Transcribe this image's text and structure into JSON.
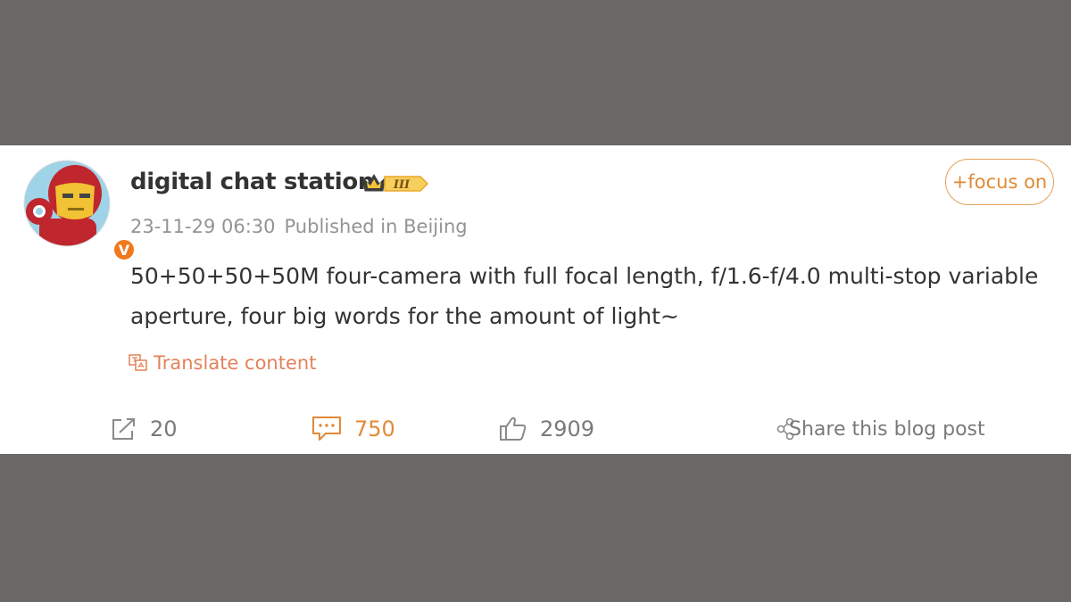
{
  "user": {
    "name": "digital chat station",
    "badge_level": "III",
    "verified_mark": "V"
  },
  "meta": {
    "timestamp": "23-11-29 06:30",
    "location": "Published in Beijing"
  },
  "follow_label": "+focus on",
  "post_text": "50+50+50+50M four-camera with full focal length, f/1.6-f/4.0 multi-stop variable aperture, four big words for the amount of light~",
  "translate_label": "Translate content",
  "actions": {
    "repost_count": "20",
    "comment_count": "750",
    "like_count": "2909",
    "share_label": "Share this blog post"
  },
  "colors": {
    "accent": "#e08a36",
    "background": "#696865",
    "card": "#ffffff"
  },
  "icons": [
    "iron-man-avatar",
    "crown-icon",
    "translate-icon",
    "repost-icon",
    "comment-icon",
    "like-icon",
    "share-icon"
  ]
}
